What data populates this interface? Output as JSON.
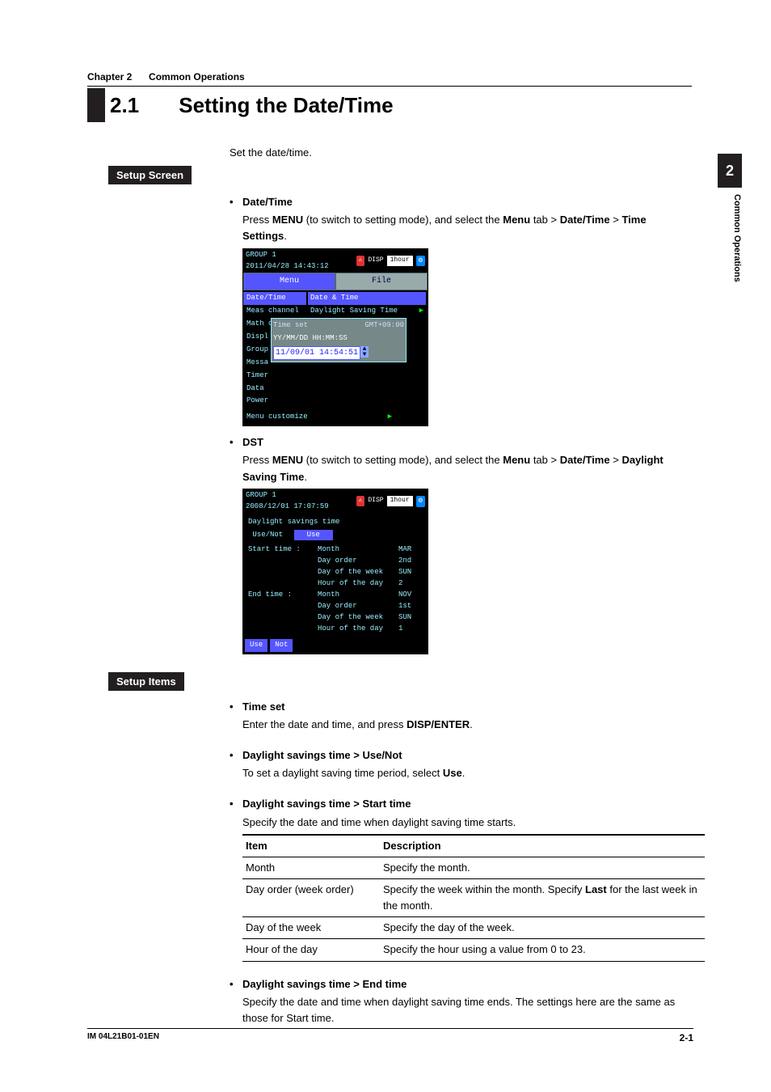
{
  "chapter": {
    "num": "Chapter 2",
    "name": "Common Operations"
  },
  "title": {
    "num": "2.1",
    "text": "Setting the Date/Time"
  },
  "side": {
    "num": "2",
    "label": "Common Operations"
  },
  "intro": "Set the date/time.",
  "heading_setup_screen": "Setup Screen",
  "heading_setup_items": "Setup Items",
  "sec_datetime": {
    "title": "Date/Time",
    "para_prefix": "Press ",
    "menu": "MENU",
    "para_mid": " (to switch to setting mode), and select the ",
    "menu_tab": "Menu",
    "gt1": " tab > ",
    "dt": "Date/Time",
    "gt2": " > ",
    "ts": "Time Settings",
    "period": "."
  },
  "sec_dst": {
    "title": "DST",
    "para_prefix": "Press ",
    "menu": "MENU",
    "para_mid": " (to switch to setting mode), and select the ",
    "menu_tab": "Menu",
    "gt1": " tab > ",
    "dt": "Date/Time",
    "gt2": " > ",
    "dst": "Daylight Saving Time",
    "period": "."
  },
  "dev1": {
    "status_group": "GROUP 1",
    "status_ts": "2011/04/28 14:43:12",
    "status_disp": "DISP",
    "status_scale": "1hour",
    "tab_menu": "Menu",
    "tab_file": "File",
    "left": [
      "Date/Time",
      "Meas channel",
      "Math channel",
      "Displ",
      "Group",
      "Messa",
      "Timer",
      "Data",
      "Power"
    ],
    "right_sel": "Date & Time",
    "right_dst": "Daylight Saving Time",
    "popup_title": "Time set",
    "popup_gmt": "GMT+09:00",
    "popup_fmt": "YY/MM/DD  HH:MM:SS",
    "popup_val": "11/09/01 14:54:51",
    "custom": "Menu customize"
  },
  "dev2": {
    "status_group": "GROUP 1",
    "status_ts": "2008/12/01 17:07:59",
    "status_disp": "DISP",
    "status_scale": "1hour",
    "heading": "Daylight savings time",
    "use_label": "Use/Not",
    "use_val": "Use",
    "rows": [
      {
        "c1": "Start time :",
        "c2": "Month",
        "c3": "MAR"
      },
      {
        "c1": "",
        "c2": "Day order",
        "c3": "2nd"
      },
      {
        "c1": "",
        "c2": "Day of the week",
        "c3": "SUN"
      },
      {
        "c1": "",
        "c2": "Hour of the day",
        "c3": "2"
      },
      {
        "c1": "End time  :",
        "c2": "Month",
        "c3": "NOV"
      },
      {
        "c1": "",
        "c2": "Day order",
        "c3": "1st"
      },
      {
        "c1": "",
        "c2": "Day of the week",
        "c3": "SUN"
      },
      {
        "c1": "",
        "c2": "Hour of the day",
        "c3": "1"
      }
    ],
    "btn_use": "Use",
    "btn_not": "Not"
  },
  "items": {
    "timeset": {
      "title": "Time set",
      "para1": "Enter the date and time, and press ",
      "key": "DISP/ENTER",
      "period": "."
    },
    "usenot": {
      "title": "Daylight savings time > Use/Not",
      "para1": "To set a daylight saving time period, select ",
      "key": "Use",
      "period": "."
    },
    "start": {
      "title": "Daylight savings time > Start time",
      "para": "Specify the date and time when daylight saving time starts."
    },
    "end": {
      "title": "Daylight savings time > End time",
      "para": "Specify the date and time when daylight saving time ends. The settings here are the same as those for Start time."
    }
  },
  "table": {
    "h_item": "Item",
    "h_desc": "Description",
    "r1_item": "Month",
    "r1_desc": "Specify the month.",
    "r2_item": "Day order (week order)",
    "r2_desc_a": "Specify the week within the month. Specify ",
    "r2_desc_b": "Last",
    "r2_desc_c": " for the last week in the month.",
    "r3_item": "Day of the week",
    "r3_desc": "Specify the day of the week.",
    "r4_item": "Hour of the day",
    "r4_desc": "Specify the hour using a value from 0 to 23."
  },
  "footer": {
    "doc": "IM 04L21B01-01EN",
    "page": "2-1"
  }
}
